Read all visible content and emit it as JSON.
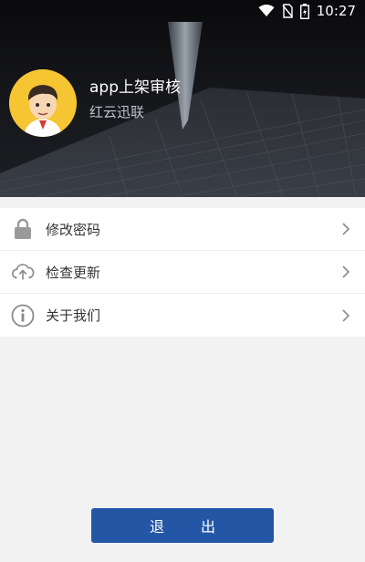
{
  "status_bar": {
    "time": "10:27",
    "icons": [
      "wifi-icon",
      "no-sim-icon",
      "battery-charging-icon"
    ]
  },
  "profile": {
    "app_name": "app上架审核",
    "company": "红云迅联",
    "avatar": "avatar-cartoon-boy"
  },
  "menu": {
    "items": [
      {
        "label": "修改密码",
        "icon": "lock-icon"
      },
      {
        "label": "检查更新",
        "icon": "cloud-upload-icon"
      },
      {
        "label": "关于我们",
        "icon": "info-icon"
      }
    ]
  },
  "logout": {
    "label": "退出"
  },
  "colors": {
    "primary_button": "#2456a6",
    "page_background": "#f2f2f2",
    "avatar_background": "#f5c532"
  }
}
